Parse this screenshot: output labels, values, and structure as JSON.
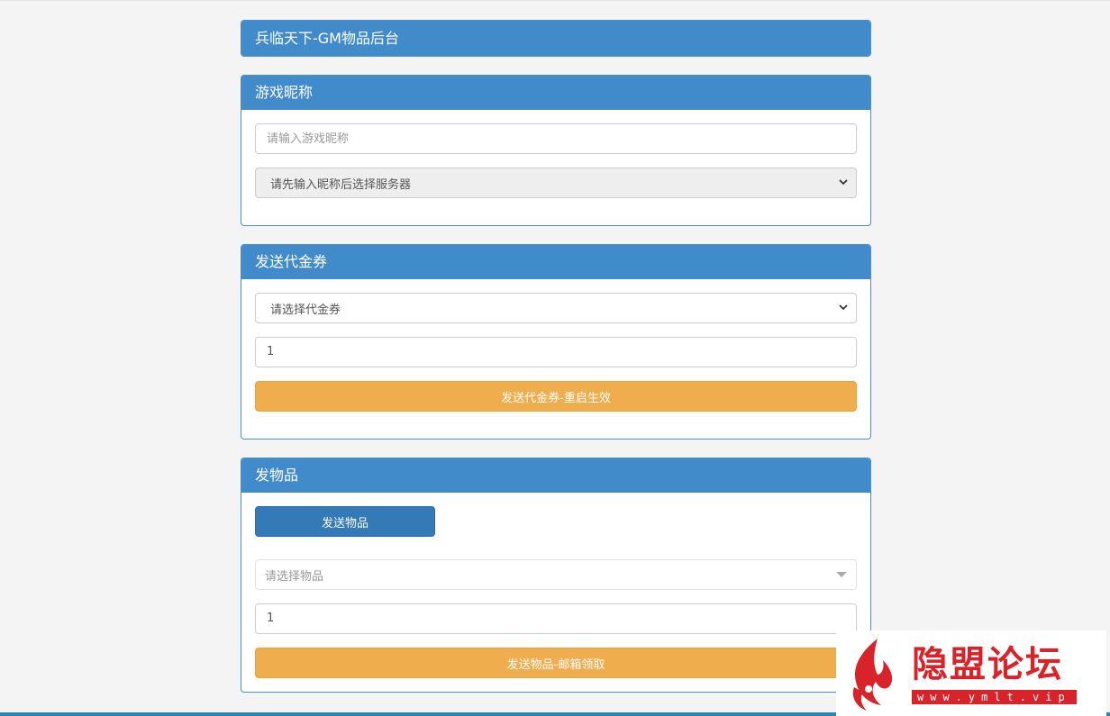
{
  "header": {
    "title": "兵临天下-GM物品后台"
  },
  "nickname_panel": {
    "title": "游戏昵称",
    "nickname_input": {
      "placeholder": "请输入游戏昵称",
      "value": ""
    },
    "server_select": {
      "selected": "请先输入昵称后选择服务器"
    }
  },
  "voucher_panel": {
    "title": "发送代金券",
    "voucher_select": {
      "selected": "请选择代金券"
    },
    "quantity": "1",
    "send_button": "发送代金券-重启生效"
  },
  "item_panel": {
    "title": "发物品",
    "send_items_tab": "发送物品",
    "item_select": {
      "placeholder": "请选择物品"
    },
    "quantity": "1",
    "send_button": "发送物品-邮箱领取"
  },
  "watermark": {
    "name": "隐盟论坛",
    "url": "www.ymlt.vip"
  },
  "icons": {
    "select_arrow": "chevron-down-icon",
    "dropdown_arrow": "caret-down-icon",
    "logo": "flame-logo"
  },
  "colors": {
    "panel_header": "#428bca",
    "warning": "#f0ad4e",
    "primary": "#337ab7",
    "watermark": "#d8232a"
  }
}
